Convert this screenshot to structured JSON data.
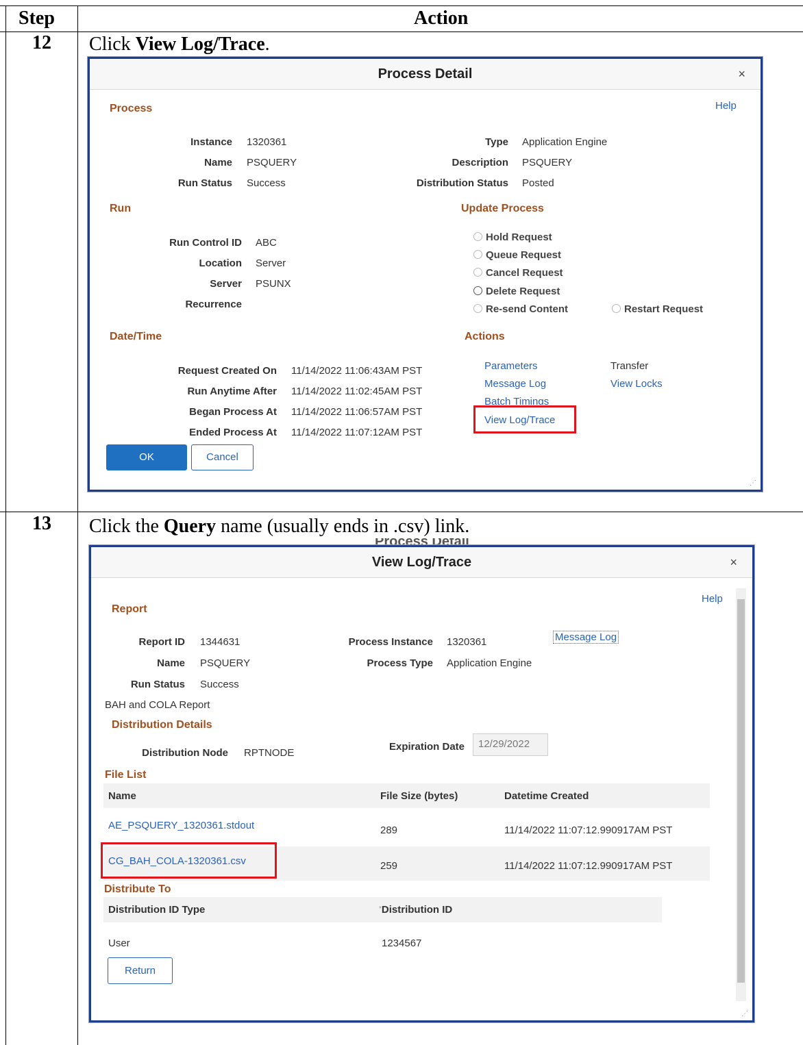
{
  "table": {
    "header_step": "Step",
    "header_action": "Action"
  },
  "step12": {
    "number": "12",
    "instr_prefix": "Click ",
    "instr_bold": "View Log/Trace",
    "instr_suffix": ".",
    "dialog": {
      "title": "Process Detail",
      "close": "×",
      "help": "Help",
      "process_section": "Process",
      "instance_label": "Instance",
      "instance_value": "1320361",
      "name_label": "Name",
      "name_value": "PSQUERY",
      "run_status_label": "Run Status",
      "run_status_value": "Success",
      "type_label": "Type",
      "type_value": "Application Engine",
      "description_label": "Description",
      "description_value": "PSQUERY",
      "dist_status_label": "Distribution Status",
      "dist_status_value": "Posted",
      "run_section": "Run",
      "run_control_label": "Run Control ID",
      "run_control_value": "ABC",
      "location_label": "Location",
      "location_value": "Server",
      "server_label": "Server",
      "server_value": "PSUNX",
      "recurrence_label": "Recurrence",
      "update_section": "Update Process",
      "radios": [
        "Hold Request",
        "Queue Request",
        "Cancel Request",
        "Delete Request",
        "Re-send Content",
        "Restart Request"
      ],
      "datetime_section": "Date/Time",
      "req_created_label": "Request Created On",
      "req_created_value": "11/14/2022 11:06:43AM PST",
      "run_anytime_label": "Run Anytime After",
      "run_anytime_value": "11/14/2022 11:02:45AM PST",
      "began_label": "Began Process At",
      "began_value": "11/14/2022 11:06:57AM PST",
      "ended_label": "Ended Process At",
      "ended_value": "11/14/2022 11:07:12AM PST",
      "actions_section": "Actions",
      "parameters": "Parameters",
      "transfer": "Transfer",
      "message_log": "Message Log",
      "view_locks": "View Locks",
      "batch_timings": "Batch Timings",
      "view_log_trace": "View Log/Trace",
      "ok": "OK",
      "cancel": "Cancel"
    }
  },
  "step13": {
    "number": "13",
    "instr_prefix": "Click the ",
    "instr_bold": "Query",
    "instr_suffix": " name (usually ends in .csv) link.",
    "behind_title": "Process Detail",
    "dialog": {
      "title": "View Log/Trace",
      "close": "×",
      "help": "Help",
      "report_section": "Report",
      "report_id_label": "Report ID",
      "report_id_value": "1344631",
      "name_label": "Name",
      "name_value": "PSQUERY",
      "run_status_label": "Run Status",
      "run_status_value": "Success",
      "proc_instance_label": "Process Instance",
      "proc_instance_value": "1320361",
      "proc_type_label": "Process Type",
      "proc_type_value": "Application Engine",
      "message_log": "Message Log",
      "report_desc": "BAH and COLA Report",
      "dist_details_section": "Distribution Details",
      "dist_node_label": "Distribution Node",
      "dist_node_value": "RPTNODE",
      "exp_date_label": "Expiration Date",
      "exp_date_value": "12/29/2022",
      "file_list_section": "File List",
      "col_name": "Name",
      "col_size": "File Size (bytes)",
      "col_created": "Datetime Created",
      "files": [
        {
          "name": "AE_PSQUERY_1320361.stdout",
          "size": "289",
          "created": "11/14/2022 11:07:12.990917AM PST"
        },
        {
          "name": "CG_BAH_COLA-1320361.csv",
          "size": "259",
          "created": "11/14/2022 11:07:12.990917AM PST"
        }
      ],
      "distribute_to_section": "Distribute To",
      "col_dist_type": "Distribution ID Type",
      "col_dist_id_marker": "*",
      "col_dist_id": "Distribution ID",
      "dist_type_value": "User",
      "dist_id_value": "1234567",
      "return": "Return"
    }
  }
}
